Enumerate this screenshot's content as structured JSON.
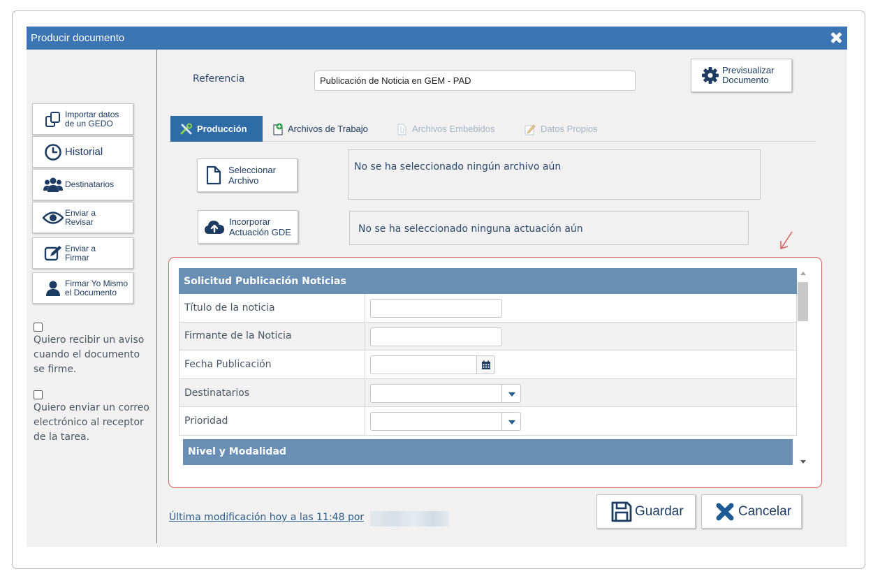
{
  "dialog": {
    "title": "Producir documento"
  },
  "sidebar": {
    "buttons": [
      {
        "label": "Importar datos de un GEDO",
        "icon": "copy-icon"
      },
      {
        "label": "Historial",
        "icon": "clock-icon"
      },
      {
        "label": "Destinatarios",
        "icon": "users-icon"
      },
      {
        "label": "Enviar a Revisar",
        "icon": "eye-icon"
      },
      {
        "label": "Enviar a Firmar",
        "icon": "sign-icon"
      },
      {
        "label": "Firmar Yo Mismo el Documento",
        "icon": "user-icon"
      }
    ],
    "checkboxes": [
      {
        "label": "Quiero recibir un aviso cuando el documento se firme.",
        "checked": false
      },
      {
        "label": "Quiero enviar un correo electrónico al receptor de la tarea.",
        "checked": false
      }
    ]
  },
  "reference": {
    "label": "Referencia",
    "value": "Publicación de Noticia en GEM - PAD"
  },
  "preview_button": {
    "label": "Previsualizar Documento",
    "icon": "gear-icon"
  },
  "tabs": [
    {
      "label": "Producción",
      "icon": "tools-icon",
      "active": true,
      "enabled": true
    },
    {
      "label": "Archivos de Trabajo",
      "icon": "file-add-icon",
      "active": false,
      "enabled": true
    },
    {
      "label": "Archivos Embebidos",
      "icon": "attach-icon",
      "active": false,
      "enabled": false
    },
    {
      "label": "Datos Propios",
      "icon": "edit-icon",
      "active": false,
      "enabled": false
    }
  ],
  "select_file": {
    "button_label": "Seleccionar Archivo",
    "status": "No se ha seleccionado ningún archivo aún"
  },
  "incorporate": {
    "button_label": "Incorporar Actuación GDE",
    "status": "No se ha seleccionado ninguna actuación aún"
  },
  "form": {
    "section_title": "Solicitud Publicación Noticias",
    "fields": [
      {
        "label": "Título de la noticia",
        "type": "text",
        "value": ""
      },
      {
        "label": "Firmante de la Noticia",
        "type": "text",
        "value": ""
      },
      {
        "label": "Fecha Publicación",
        "type": "date",
        "value": ""
      },
      {
        "label": "Destinatarios",
        "type": "select",
        "value": ""
      },
      {
        "label": "Prioridad",
        "type": "select",
        "value": ""
      }
    ],
    "subsection_title": "Nivel y Modalidad"
  },
  "footer": {
    "last_modified": "Última modificación hoy a las 11:48 por",
    "save_label": "Guardar",
    "cancel_label": "Cancelar"
  },
  "colors": {
    "titlebar": "#3b75b3",
    "tab_active": "#2e6ca8",
    "section_header": "#6a8fb5",
    "highlight_border": "#dd6161",
    "cancel_icon": "#1e5a93"
  }
}
